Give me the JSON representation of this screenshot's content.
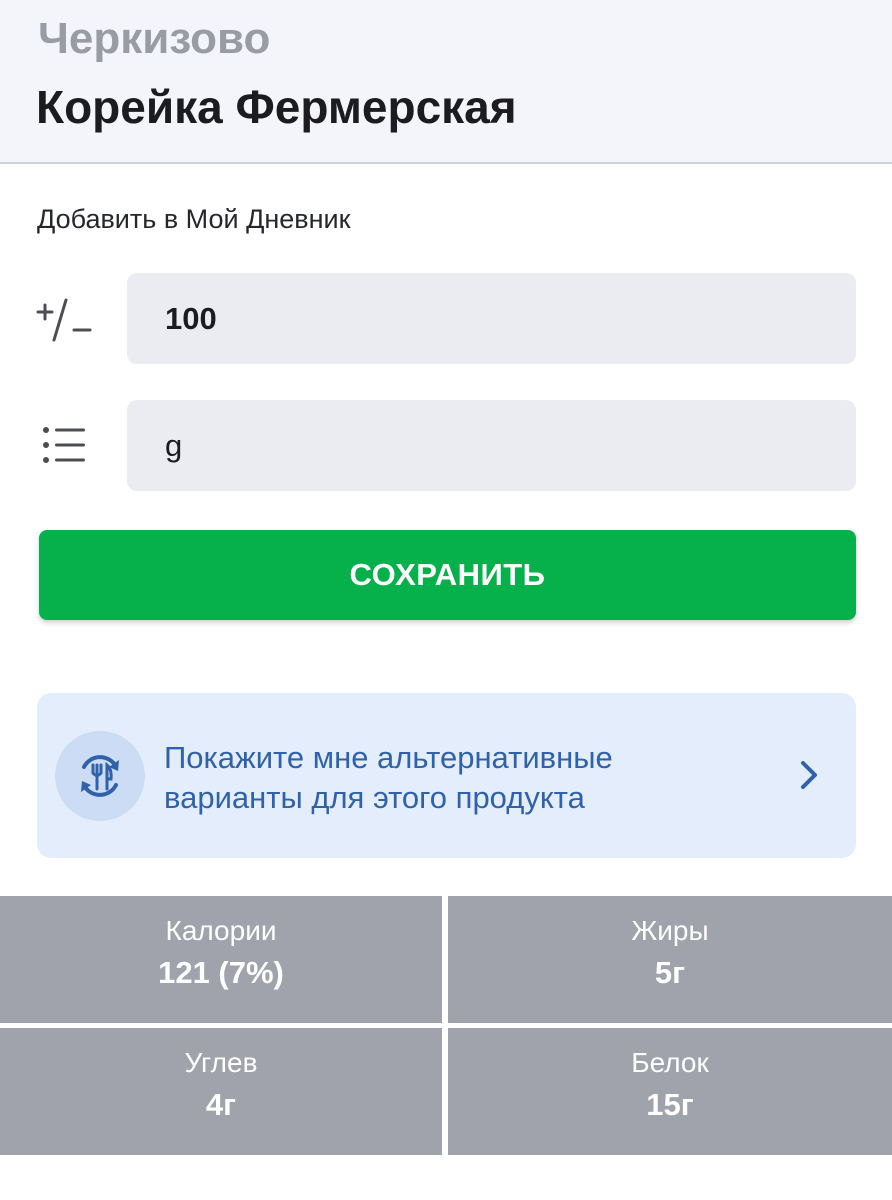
{
  "header": {
    "brand": "Черкизово",
    "title": "Корейка Фермерская"
  },
  "diary": {
    "section_label": "Добавить в Мой Дневник",
    "amount_icon": "plus-minus-icon",
    "amount_value": "100",
    "unit_icon": "list-icon",
    "unit_value": "g",
    "save_label": "СОХРАНИТЬ"
  },
  "alternatives": {
    "icon": "swap-cutlery-icon",
    "text": "Покажите мне альтернативные варианты для этого продукта",
    "chevron_icon": "chevron-right-icon"
  },
  "nutrition": [
    {
      "label": "Калории",
      "value": "121 (7%)"
    },
    {
      "label": "Жиры",
      "value": "5г"
    },
    {
      "label": "Углев",
      "value": "4г"
    },
    {
      "label": "Белок",
      "value": "15г"
    }
  ],
  "colors": {
    "accent_green": "#06b14b",
    "alt_card_bg": "#e4edfb",
    "alt_text": "#2f62aa",
    "nutrition_bg": "#a0a3ab"
  }
}
